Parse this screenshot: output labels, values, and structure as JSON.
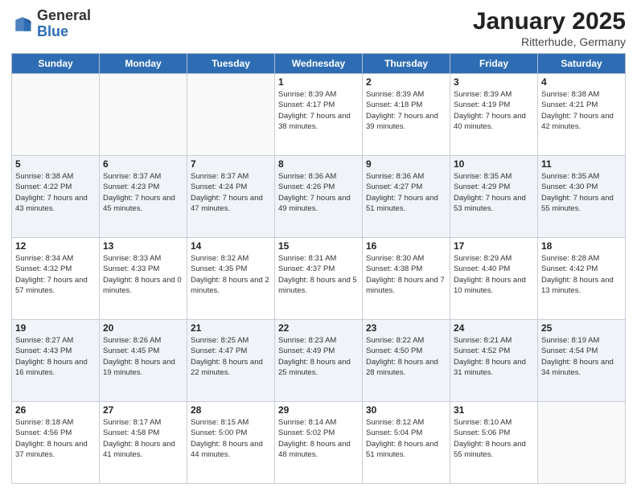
{
  "header": {
    "logo_general": "General",
    "logo_blue": "Blue",
    "month_title": "January 2025",
    "subtitle": "Ritterhude, Germany"
  },
  "days_of_week": [
    "Sunday",
    "Monday",
    "Tuesday",
    "Wednesday",
    "Thursday",
    "Friday",
    "Saturday"
  ],
  "weeks": [
    [
      {
        "day": "",
        "sunrise": "",
        "sunset": "",
        "daylight": ""
      },
      {
        "day": "",
        "sunrise": "",
        "sunset": "",
        "daylight": ""
      },
      {
        "day": "",
        "sunrise": "",
        "sunset": "",
        "daylight": ""
      },
      {
        "day": "1",
        "sunrise": "Sunrise: 8:39 AM",
        "sunset": "Sunset: 4:17 PM",
        "daylight": "Daylight: 7 hours and 38 minutes."
      },
      {
        "day": "2",
        "sunrise": "Sunrise: 8:39 AM",
        "sunset": "Sunset: 4:18 PM",
        "daylight": "Daylight: 7 hours and 39 minutes."
      },
      {
        "day": "3",
        "sunrise": "Sunrise: 8:39 AM",
        "sunset": "Sunset: 4:19 PM",
        "daylight": "Daylight: 7 hours and 40 minutes."
      },
      {
        "day": "4",
        "sunrise": "Sunrise: 8:38 AM",
        "sunset": "Sunset: 4:21 PM",
        "daylight": "Daylight: 7 hours and 42 minutes."
      }
    ],
    [
      {
        "day": "5",
        "sunrise": "Sunrise: 8:38 AM",
        "sunset": "Sunset: 4:22 PM",
        "daylight": "Daylight: 7 hours and 43 minutes."
      },
      {
        "day": "6",
        "sunrise": "Sunrise: 8:37 AM",
        "sunset": "Sunset: 4:23 PM",
        "daylight": "Daylight: 7 hours and 45 minutes."
      },
      {
        "day": "7",
        "sunrise": "Sunrise: 8:37 AM",
        "sunset": "Sunset: 4:24 PM",
        "daylight": "Daylight: 7 hours and 47 minutes."
      },
      {
        "day": "8",
        "sunrise": "Sunrise: 8:36 AM",
        "sunset": "Sunset: 4:26 PM",
        "daylight": "Daylight: 7 hours and 49 minutes."
      },
      {
        "day": "9",
        "sunrise": "Sunrise: 8:36 AM",
        "sunset": "Sunset: 4:27 PM",
        "daylight": "Daylight: 7 hours and 51 minutes."
      },
      {
        "day": "10",
        "sunrise": "Sunrise: 8:35 AM",
        "sunset": "Sunset: 4:29 PM",
        "daylight": "Daylight: 7 hours and 53 minutes."
      },
      {
        "day": "11",
        "sunrise": "Sunrise: 8:35 AM",
        "sunset": "Sunset: 4:30 PM",
        "daylight": "Daylight: 7 hours and 55 minutes."
      }
    ],
    [
      {
        "day": "12",
        "sunrise": "Sunrise: 8:34 AM",
        "sunset": "Sunset: 4:32 PM",
        "daylight": "Daylight: 7 hours and 57 minutes."
      },
      {
        "day": "13",
        "sunrise": "Sunrise: 8:33 AM",
        "sunset": "Sunset: 4:33 PM",
        "daylight": "Daylight: 8 hours and 0 minutes."
      },
      {
        "day": "14",
        "sunrise": "Sunrise: 8:32 AM",
        "sunset": "Sunset: 4:35 PM",
        "daylight": "Daylight: 8 hours and 2 minutes."
      },
      {
        "day": "15",
        "sunrise": "Sunrise: 8:31 AM",
        "sunset": "Sunset: 4:37 PM",
        "daylight": "Daylight: 8 hours and 5 minutes."
      },
      {
        "day": "16",
        "sunrise": "Sunrise: 8:30 AM",
        "sunset": "Sunset: 4:38 PM",
        "daylight": "Daylight: 8 hours and 7 minutes."
      },
      {
        "day": "17",
        "sunrise": "Sunrise: 8:29 AM",
        "sunset": "Sunset: 4:40 PM",
        "daylight": "Daylight: 8 hours and 10 minutes."
      },
      {
        "day": "18",
        "sunrise": "Sunrise: 8:28 AM",
        "sunset": "Sunset: 4:42 PM",
        "daylight": "Daylight: 8 hours and 13 minutes."
      }
    ],
    [
      {
        "day": "19",
        "sunrise": "Sunrise: 8:27 AM",
        "sunset": "Sunset: 4:43 PM",
        "daylight": "Daylight: 8 hours and 16 minutes."
      },
      {
        "day": "20",
        "sunrise": "Sunrise: 8:26 AM",
        "sunset": "Sunset: 4:45 PM",
        "daylight": "Daylight: 8 hours and 19 minutes."
      },
      {
        "day": "21",
        "sunrise": "Sunrise: 8:25 AM",
        "sunset": "Sunset: 4:47 PM",
        "daylight": "Daylight: 8 hours and 22 minutes."
      },
      {
        "day": "22",
        "sunrise": "Sunrise: 8:23 AM",
        "sunset": "Sunset: 4:49 PM",
        "daylight": "Daylight: 8 hours and 25 minutes."
      },
      {
        "day": "23",
        "sunrise": "Sunrise: 8:22 AM",
        "sunset": "Sunset: 4:50 PM",
        "daylight": "Daylight: 8 hours and 28 minutes."
      },
      {
        "day": "24",
        "sunrise": "Sunrise: 8:21 AM",
        "sunset": "Sunset: 4:52 PM",
        "daylight": "Daylight: 8 hours and 31 minutes."
      },
      {
        "day": "25",
        "sunrise": "Sunrise: 8:19 AM",
        "sunset": "Sunset: 4:54 PM",
        "daylight": "Daylight: 8 hours and 34 minutes."
      }
    ],
    [
      {
        "day": "26",
        "sunrise": "Sunrise: 8:18 AM",
        "sunset": "Sunset: 4:56 PM",
        "daylight": "Daylight: 8 hours and 37 minutes."
      },
      {
        "day": "27",
        "sunrise": "Sunrise: 8:17 AM",
        "sunset": "Sunset: 4:58 PM",
        "daylight": "Daylight: 8 hours and 41 minutes."
      },
      {
        "day": "28",
        "sunrise": "Sunrise: 8:15 AM",
        "sunset": "Sunset: 5:00 PM",
        "daylight": "Daylight: 8 hours and 44 minutes."
      },
      {
        "day": "29",
        "sunrise": "Sunrise: 8:14 AM",
        "sunset": "Sunset: 5:02 PM",
        "daylight": "Daylight: 8 hours and 48 minutes."
      },
      {
        "day": "30",
        "sunrise": "Sunrise: 8:12 AM",
        "sunset": "Sunset: 5:04 PM",
        "daylight": "Daylight: 8 hours and 51 minutes."
      },
      {
        "day": "31",
        "sunrise": "Sunrise: 8:10 AM",
        "sunset": "Sunset: 5:06 PM",
        "daylight": "Daylight: 8 hours and 55 minutes."
      },
      {
        "day": "",
        "sunrise": "",
        "sunset": "",
        "daylight": ""
      }
    ]
  ]
}
